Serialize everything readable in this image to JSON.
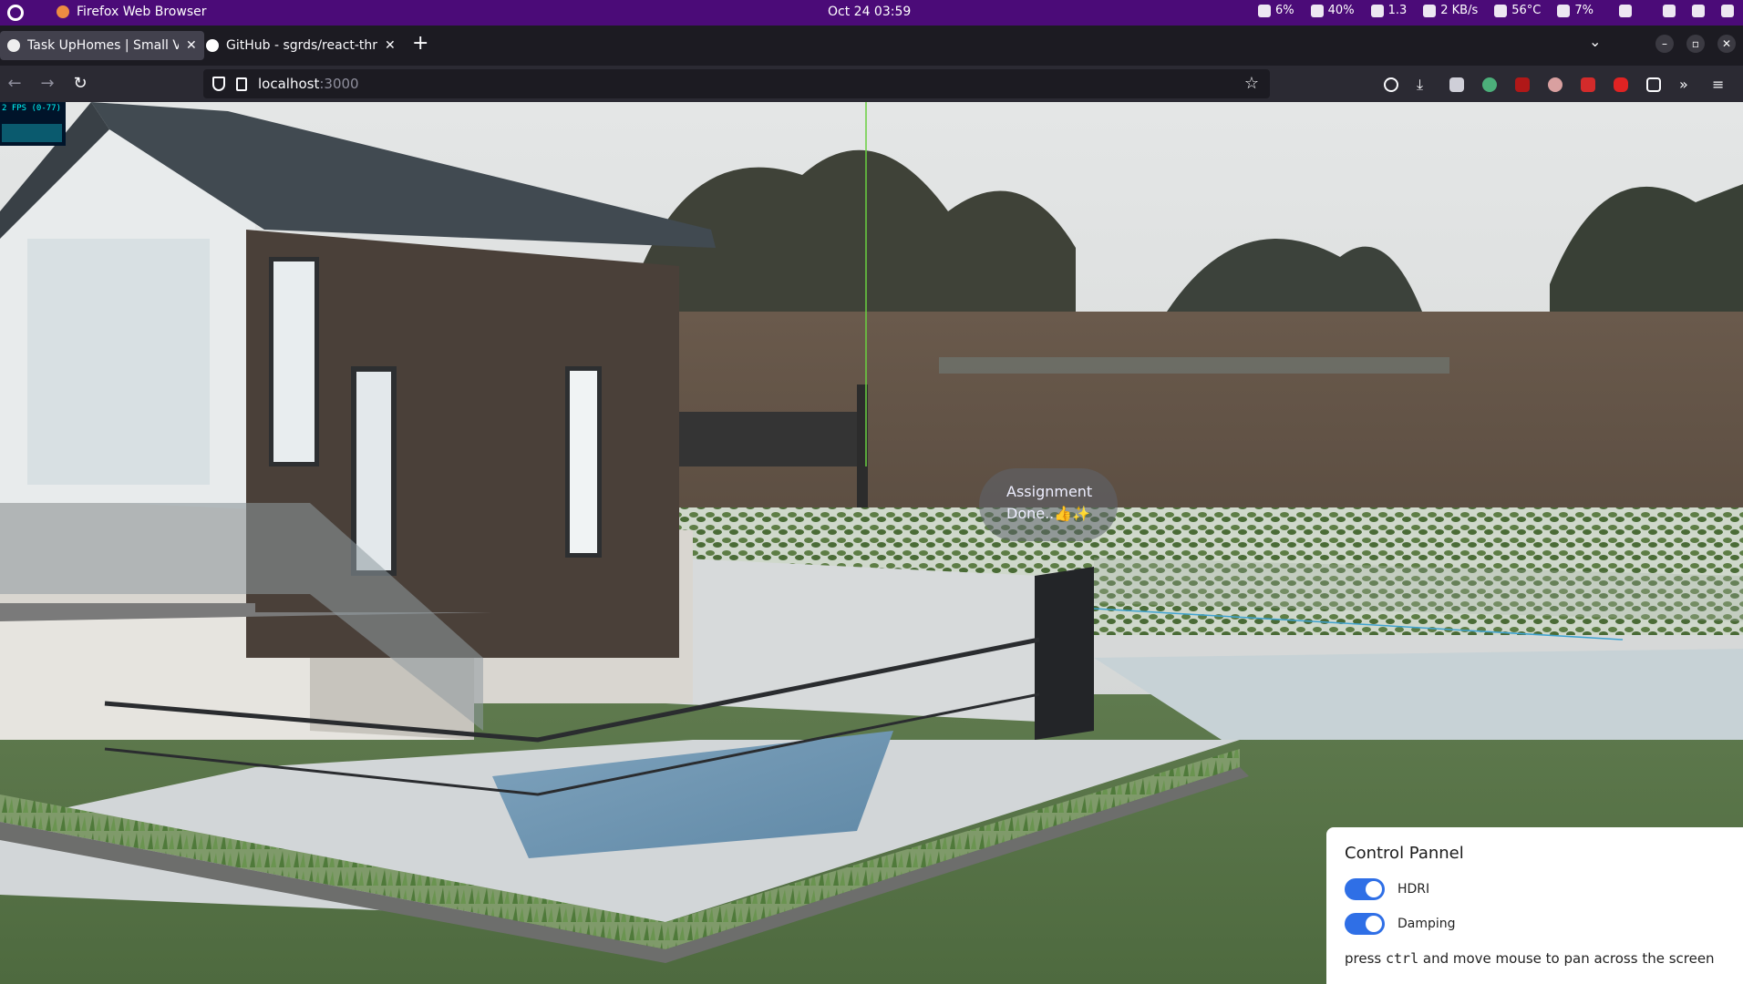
{
  "topbar": {
    "app_name": "Firefox Web Browser",
    "datetime": "Oct 24  03:59",
    "stats": [
      {
        "icon": "weather-icon",
        "value": "6%"
      },
      {
        "icon": "memory-icon",
        "value": "40%"
      },
      {
        "icon": "load-icon",
        "value": "1.3"
      },
      {
        "icon": "network-icon",
        "value": "2 KB/s"
      },
      {
        "icon": "temperature-icon",
        "value": "56°C"
      },
      {
        "icon": "disk-icon",
        "value": "7%"
      }
    ]
  },
  "tabs": [
    {
      "label": "Task UpHomes | Small Vil",
      "active": true
    },
    {
      "label": "GitHub - sgrds/react-thre",
      "active": false
    }
  ],
  "url": {
    "host": "localhost",
    "port": ":3000"
  },
  "fps": {
    "label": "2 FPS (0-77)"
  },
  "tooltip": {
    "line1": "Assignment",
    "line2": "Done..👍✨"
  },
  "control_panel": {
    "title": "Control Pannel",
    "toggles": [
      {
        "label": "HDRI",
        "on": true
      },
      {
        "label": "Damping",
        "on": true
      }
    ],
    "hint_before": "press ",
    "hint_key": "ctrl",
    "hint_after": " and move mouse to pan across the screen"
  },
  "colors": {
    "accent": "#2f6fe6",
    "topbar": "#4b0b78"
  }
}
